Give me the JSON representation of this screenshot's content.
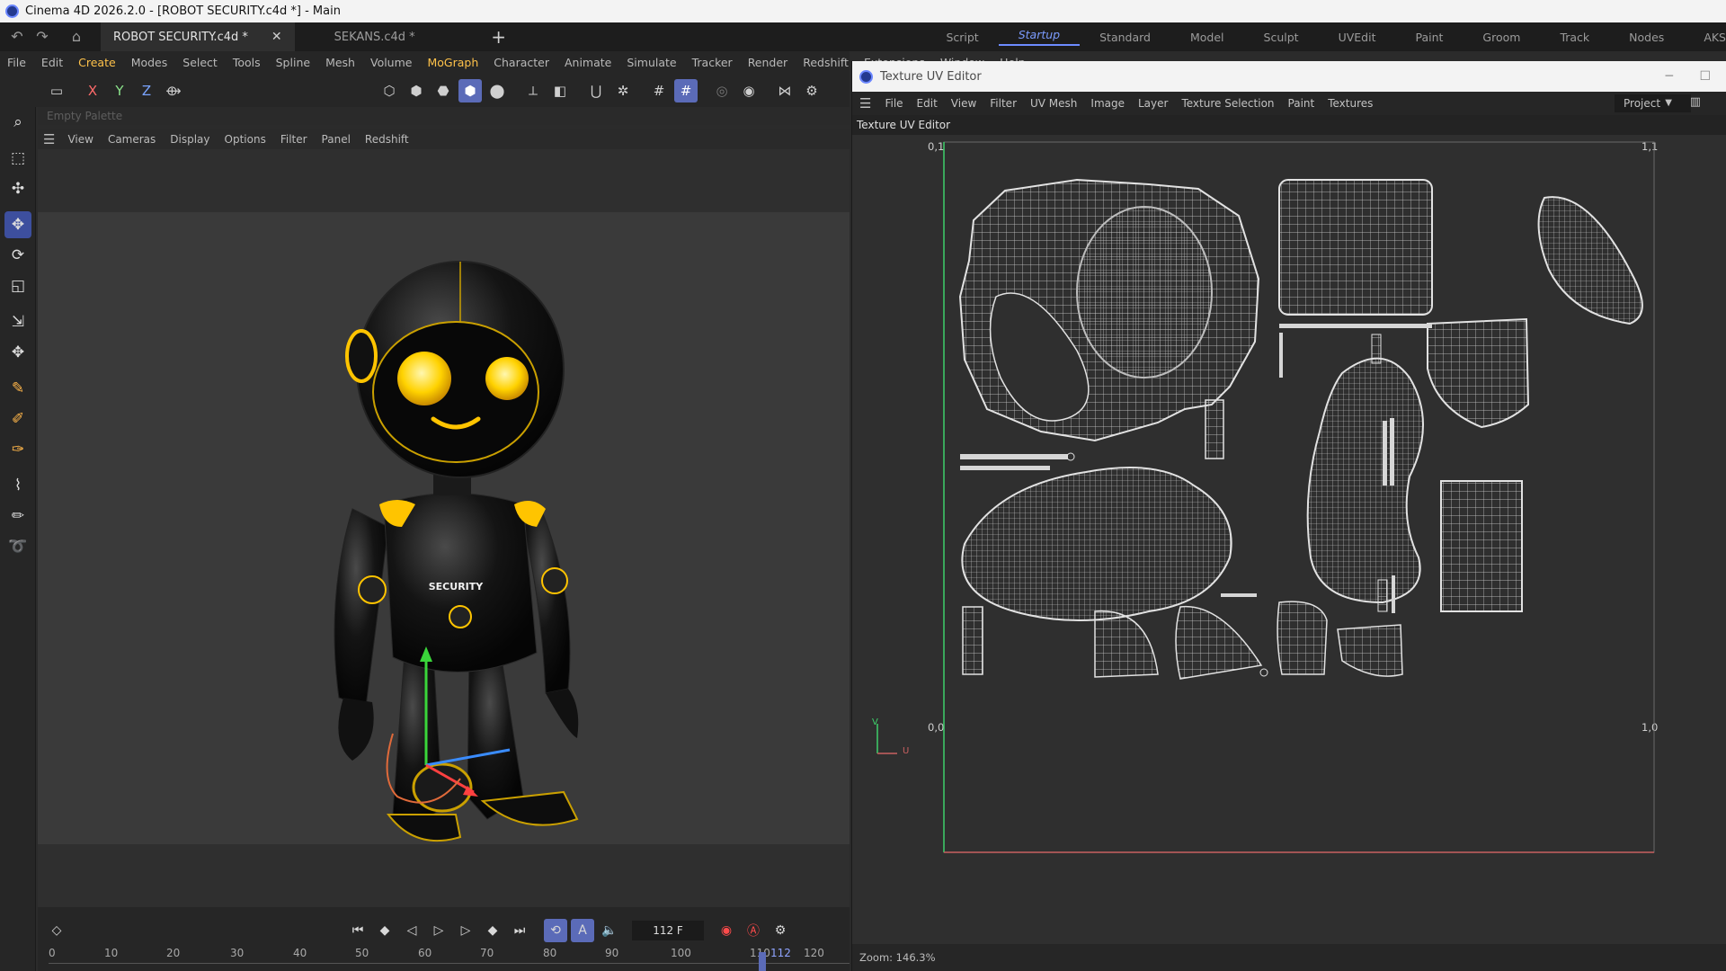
{
  "app_title": "Cinema 4D 2026.2.0 - [ROBOT SECURITY.c4d *] - Main",
  "doc_tabs": [
    {
      "label": "ROBOT SECURITY.c4d *",
      "close": "✕"
    },
    {
      "label": "SEKANS.c4d *"
    }
  ],
  "new_tab_symbol": "+",
  "layouts": [
    "Script",
    "Startup",
    "Standard",
    "Model",
    "Sculpt",
    "UVEdit",
    "Paint",
    "Groom",
    "Track",
    "Nodes",
    "AKS"
  ],
  "active_layout": "Startup",
  "menubar": [
    "File",
    "Edit",
    "Create",
    "Modes",
    "Select",
    "Tools",
    "Spline",
    "Mesh",
    "Volume",
    "MoGraph",
    "Character",
    "Animate",
    "Simulate",
    "Tracker",
    "Render",
    "Redshift",
    "Extensions",
    "Window",
    "Help"
  ],
  "menubar_highlight": [
    "Create",
    "MoGraph"
  ],
  "toolbar_axes": [
    "X",
    "Y",
    "Z"
  ],
  "palette_label": "Empty Palette",
  "viewport_menu": [
    "View",
    "Cameras",
    "Display",
    "Options",
    "Filter",
    "Panel",
    "Redshift"
  ],
  "robot": {
    "chest_text": "SECURITY"
  },
  "timeline": {
    "frame_value": "112 F",
    "current_frame_label": "112",
    "ruler_ticks": [
      "0",
      "10",
      "20",
      "30",
      "40",
      "50",
      "60",
      "70",
      "80",
      "90",
      "100",
      "110",
      "120"
    ]
  },
  "uv_editor": {
    "window_title": "Texture UV Editor",
    "menu": [
      "File",
      "Edit",
      "View",
      "Filter",
      "UV Mesh",
      "Image",
      "Layer",
      "Texture Selection",
      "Paint",
      "Textures"
    ],
    "project_select": "Project",
    "panel_label": "Texture UV Editor",
    "corners": {
      "top_left": "0,1",
      "top_right": "1,1",
      "bottom_left": "0,0",
      "bottom_right": "1,0"
    },
    "axis_v": "V",
    "axis_u": "U",
    "status": "Zoom: 146.3%"
  },
  "colors": {
    "accent": "#6d8cff",
    "highlight_menu": "#ffc24a",
    "robot_yellow": "#ffc400",
    "uv_wire": "#d6d6d6"
  }
}
